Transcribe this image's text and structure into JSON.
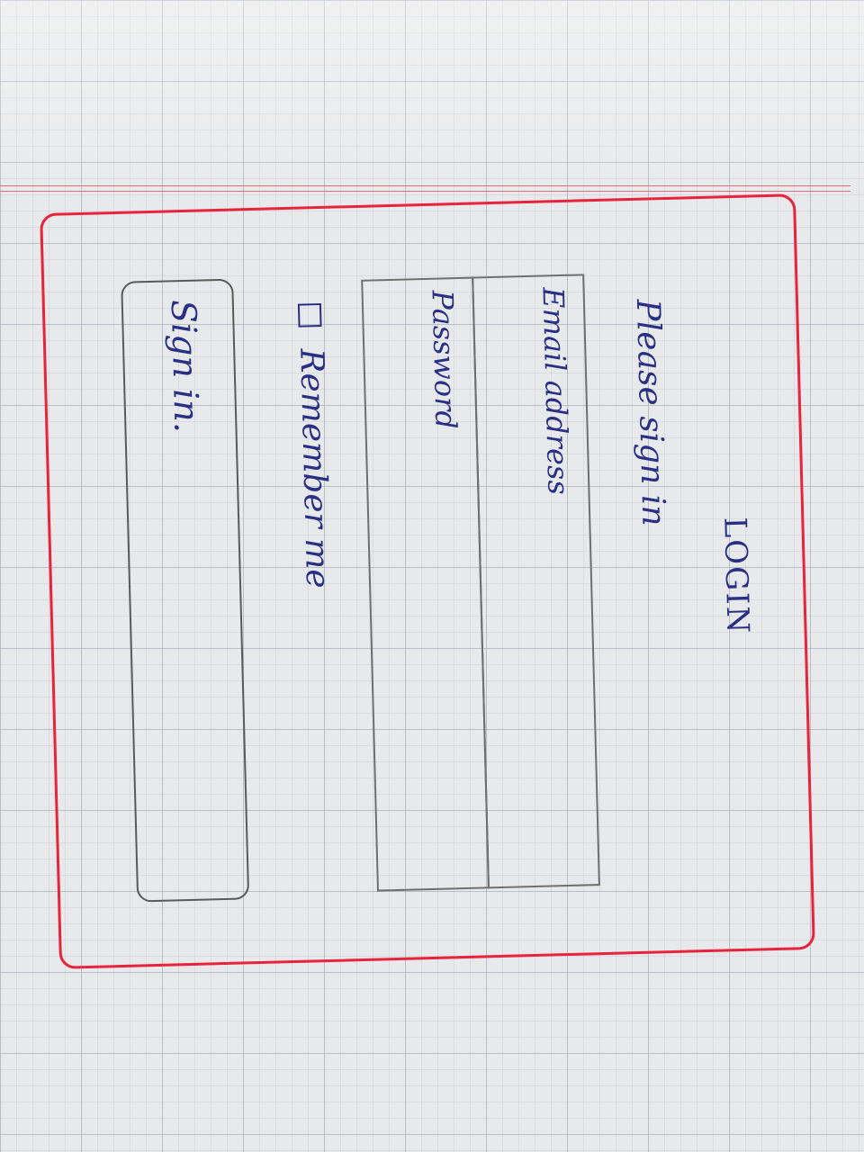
{
  "login": {
    "title": "LOGIN",
    "subtitle": "Please sign in",
    "email_label": "Email address",
    "password_label": "Password",
    "remember_label": "Remember me",
    "remember_checked": false,
    "signin_label": "Sign in."
  },
  "colors": {
    "card_border": "#e8233c",
    "ink": "#2a2f86",
    "pencil": "#6f6f6f"
  }
}
